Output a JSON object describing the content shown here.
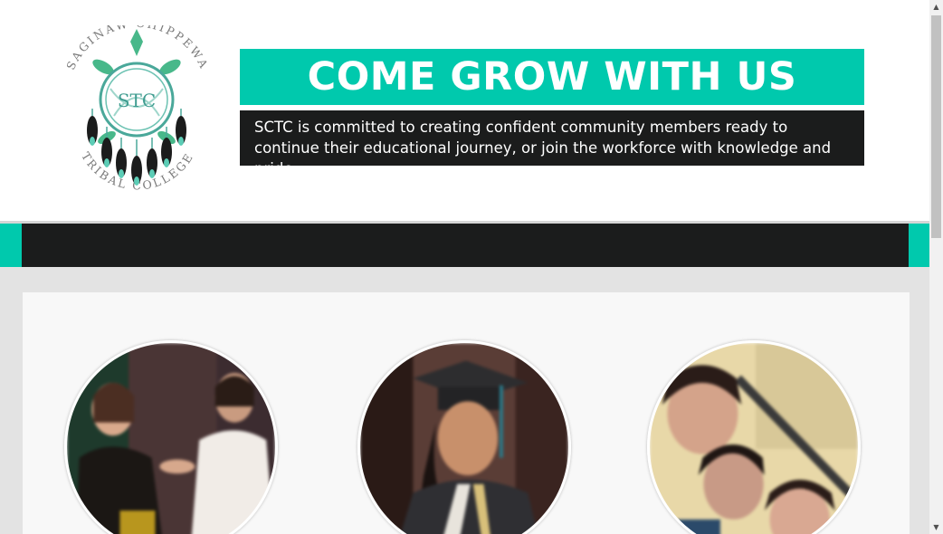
{
  "header": {
    "logo": {
      "icon": "turtle-dreamcatcher-logo",
      "text_top": "SAGINAW CHIPPEWA",
      "text_bottom": "TRIBAL COLLEGE",
      "center_letters": "STC"
    },
    "banner_title": "COME GROW WITH US",
    "tagline": "SCTC is committed to creating confident community members ready to continue their educational journey, or join the workforce with knowledge and pride"
  },
  "colors": {
    "accent": "#00c9ad",
    "dark": "#1b1c1c",
    "content_bg": "#e3e3e3",
    "panel_bg": "#f8f8f8"
  },
  "photos": [
    {
      "name": "photo-handshake",
      "desc_icon": "people-photo"
    },
    {
      "name": "photo-graduate",
      "desc_icon": "person-photo"
    },
    {
      "name": "photo-group-selfie",
      "desc_icon": "people-photo"
    }
  ],
  "scrollbar": {
    "up_icon": "scroll-up-arrow-icon",
    "down_icon": "scroll-down-arrow-icon",
    "position_fraction": 0.0
  }
}
